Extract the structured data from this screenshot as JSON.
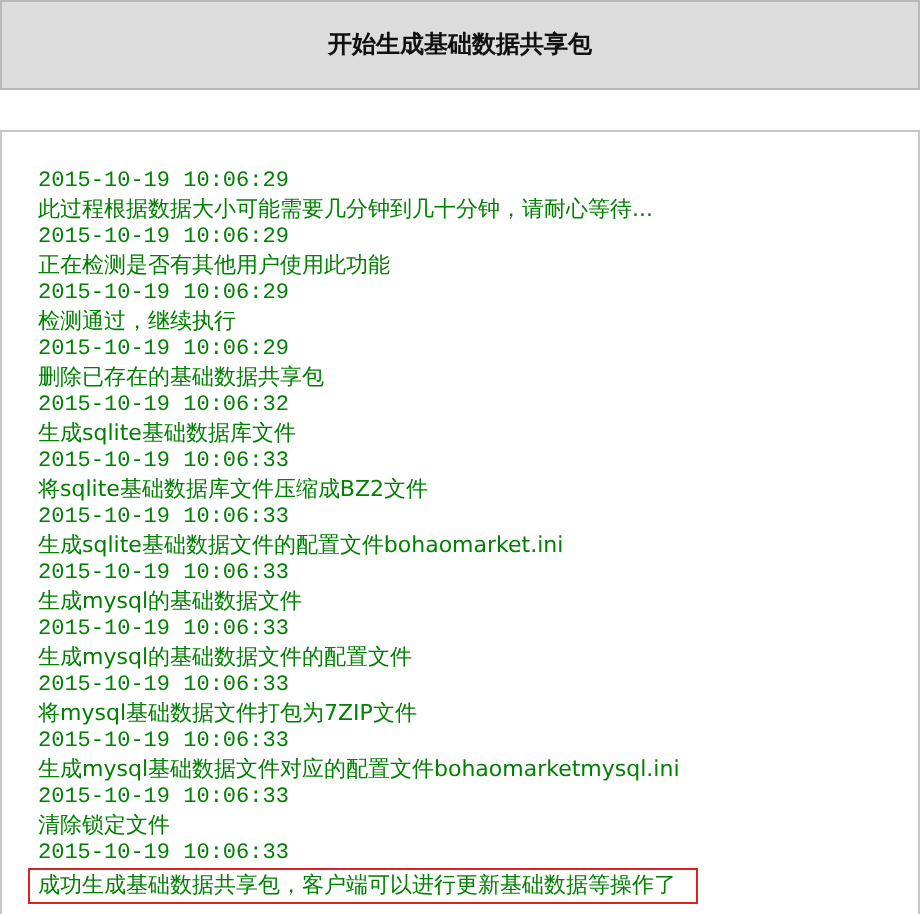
{
  "header": {
    "title": "开始生成基础数据共享包"
  },
  "log": [
    {
      "time": "2015-10-19 10:06:29",
      "message": "此过程根据数据大小可能需要几分钟到几十分钟，请耐心等待...",
      "highlighted": false
    },
    {
      "time": "2015-10-19 10:06:29",
      "message": "正在检测是否有其他用户使用此功能",
      "highlighted": false
    },
    {
      "time": "2015-10-19 10:06:29",
      "message": "检测通过，继续执行",
      "highlighted": false
    },
    {
      "time": "2015-10-19 10:06:29",
      "message": "删除已存在的基础数据共享包",
      "highlighted": false
    },
    {
      "time": "2015-10-19 10:06:32",
      "message": "生成sqlite基础数据库文件",
      "highlighted": false
    },
    {
      "time": "2015-10-19 10:06:33",
      "message": "将sqlite基础数据库文件压缩成BZ2文件",
      "highlighted": false
    },
    {
      "time": "2015-10-19 10:06:33",
      "message": "生成sqlite基础数据文件的配置文件bohaomarket.ini",
      "highlighted": false
    },
    {
      "time": "2015-10-19 10:06:33",
      "message": "生成mysql的基础数据文件",
      "highlighted": false
    },
    {
      "time": "2015-10-19 10:06:33",
      "message": "生成mysql的基础数据文件的配置文件",
      "highlighted": false
    },
    {
      "time": "2015-10-19 10:06:33",
      "message": "将mysql基础数据文件打包为7ZIP文件",
      "highlighted": false
    },
    {
      "time": "2015-10-19 10:06:33",
      "message": "生成mysql基础数据文件对应的配置文件bohaomarketmysql.ini",
      "highlighted": false
    },
    {
      "time": "2015-10-19 10:06:33",
      "message": "清除锁定文件",
      "highlighted": false
    },
    {
      "time": "2015-10-19 10:06:33",
      "message": "成功生成基础数据共享包，客户端可以进行更新基础数据等操作了",
      "highlighted": true
    }
  ]
}
